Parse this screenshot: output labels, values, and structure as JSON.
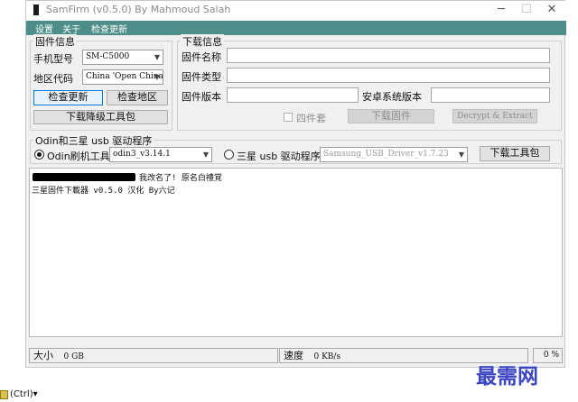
{
  "window": {
    "title": "SamFirm  (v0.5.0) By Mahmoud Salah",
    "minimize": "─",
    "maximize": "☐",
    "close": "✕"
  },
  "menu": {
    "items": [
      "设置",
      "关于",
      "检查更新"
    ]
  },
  "firmware_info": {
    "title": "固件信息",
    "model_label": "手机型号",
    "model_value": "SM-C5000",
    "region_label": "地区代码",
    "region_value": "China 'Open China'",
    "check_update_button": "检查更新",
    "check_region_button": "检查地区",
    "downgrade_button": "下载降级工具包"
  },
  "download_info": {
    "title": "下载信息",
    "name_label": "固件名称",
    "type_label": "固件类型",
    "version_label": "固件版本",
    "android_label": "安卓系统版本",
    "quad_label": "四件套",
    "quad_checked": false,
    "download_button": "下载固件",
    "decrypt_button": "Decrypt & Extract"
  },
  "odin": {
    "title": "Odin和三星 usb 驱动程序",
    "odin_label": "Odin刷机工具",
    "odin_selected": true,
    "odin_value": "odin3_v3.14.1",
    "driver_label": "三星 usb 驱动程序",
    "driver_selected": false,
    "driver_value": "Samsung_USB_Driver_v1.7.23",
    "download_tools_button": "下载工具包"
  },
  "log": {
    "line1": "我改名了! 原名白禮覚",
    "line2": "三星固件下載器 v0.5.0 汉化 By六记"
  },
  "status": {
    "size_label": "大小",
    "size_value": "0 GB",
    "speed_label": "速度",
    "speed_value": "0 KB/s",
    "progress_percent": "0 %"
  },
  "watermark": "最需网",
  "taskbar": {
    "label": "(Ctrl)▾"
  }
}
